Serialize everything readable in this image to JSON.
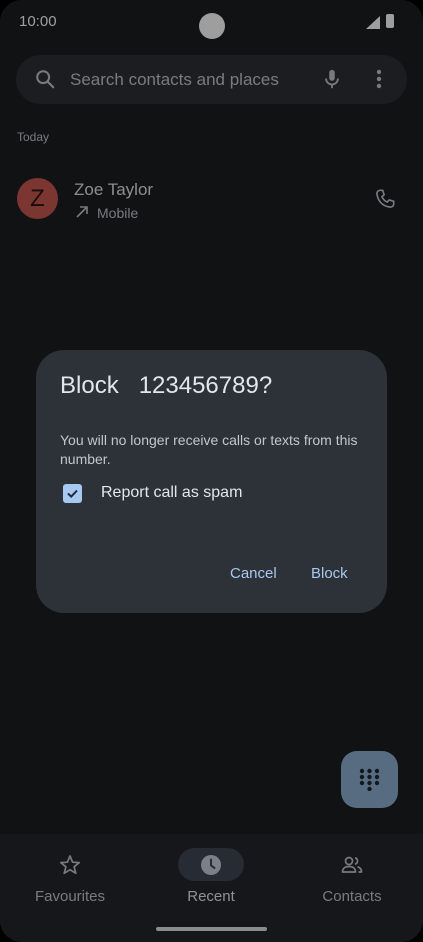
{
  "status_bar": {
    "time": "10:00"
  },
  "search": {
    "placeholder": "Search contacts and places"
  },
  "recents": {
    "section_label": "Today",
    "calls": [
      {
        "initial": "Z",
        "name": "Zoe Taylor",
        "type": "Mobile",
        "direction_icon": "outgoing-arrow-icon"
      }
    ]
  },
  "bottom_nav": {
    "items": [
      {
        "label": "Favourites",
        "icon": "star-icon",
        "active": false
      },
      {
        "label": "Recent",
        "icon": "clock-icon",
        "active": true
      },
      {
        "label": "Contacts",
        "icon": "people-icon",
        "active": false
      }
    ]
  },
  "dialog": {
    "title": "Block   123456789?",
    "body": "You will no longer receive calls or texts from this number.",
    "checkbox_label": "Report call as spam",
    "checkbox_checked": true,
    "cancel_label": "Cancel",
    "confirm_label": "Block"
  },
  "colors": {
    "avatar": "#c7584f",
    "accent": "#a9c7ef",
    "fab": "#8faed0",
    "dialog_bg": "#2c3238"
  }
}
